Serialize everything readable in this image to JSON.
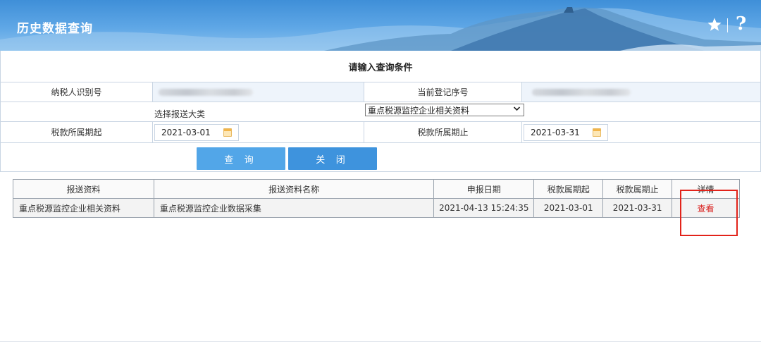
{
  "header": {
    "title": "历史数据查询",
    "icons": [
      "star-icon",
      "help-icon"
    ],
    "help_glyph": "?"
  },
  "form": {
    "caption": "请输入查询条件",
    "taxpayer_id_label": "纳税人识别号",
    "reg_seq_label": "当前登记序号",
    "category_label": "选择报送大类",
    "category_value": "重点税源监控企业相关资料",
    "period_start_label": "税款所属期起",
    "period_start_value": "2021-03-01",
    "period_end_label": "税款所属期止",
    "period_end_value": "2021-03-31",
    "query_button": "查 询",
    "close_button": "关 闭"
  },
  "results": {
    "headers": [
      "报送资料",
      "报送资料名称",
      "申报日期",
      "税款属期起",
      "税款属期止",
      "详情"
    ],
    "rows": [
      {
        "material": "重点税源监控企业相关资料",
        "name": "重点税源监控企业数据采集",
        "declare_date": "2021-04-13 15:24:35",
        "start": "2021-03-01",
        "end": "2021-03-31",
        "detail": "查看"
      }
    ]
  },
  "colors": {
    "header_blue": "#3f8fd8",
    "button_blue": "#52a6e8",
    "highlight_red": "#e2231a",
    "link_red": "#d8201e"
  }
}
